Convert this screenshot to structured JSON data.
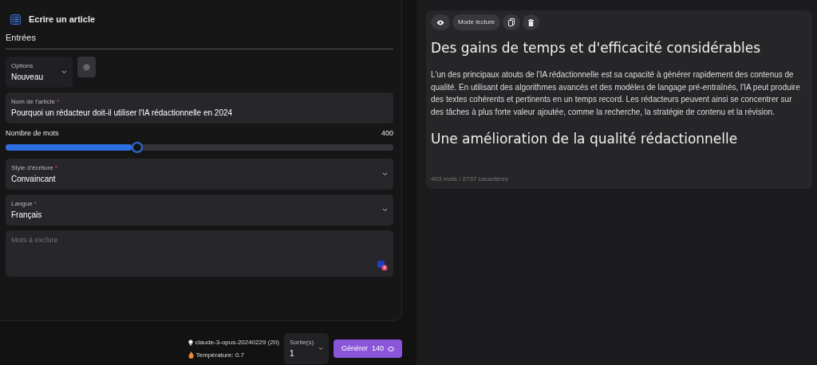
{
  "header": {
    "title": "Ecrire un article"
  },
  "section_title": "Entrées",
  "options_select": {
    "label": "Options",
    "value": "Nouveau"
  },
  "fields": [
    {
      "kind": "input",
      "label": "Nom de l'article",
      "required_mark": "*",
      "value": "Pourquoi un rédacteur doit-il utiliser l'IA rédactionnelle en 2024"
    }
  ],
  "word_count": {
    "label": "Nombre de mots",
    "reading": "400",
    "level": 0.34
  },
  "selects": [
    {
      "label": "Style d'écriture",
      "required_mark": "*",
      "value": "Convaincant"
    },
    {
      "label": "Langue",
      "required_mark": "*",
      "value": "Français"
    }
  ],
  "exclude_field": {
    "placeholder": "Mots à exclure"
  },
  "footer": {
    "model": "claude-3-opus-20240229 (20)",
    "temperature": "Température: 0.7",
    "output_select": {
      "label": "Sortie(s)",
      "value": "1"
    },
    "generate_button": {
      "label": "Générer",
      "cost": "140"
    }
  },
  "preview": {
    "toolbar": {
      "mode_button": "Mode lecture"
    },
    "content": [
      {
        "kind": "heading",
        "text": "Des gains de temps et d'efficacité considérables"
      },
      {
        "kind": "paragraph",
        "text": "L'un des principaux atouts de l'IA rédactionnelle est sa capacité à générer rapidement des contenus de qualité. En utilisant des algorithmes avancés et des modèles de langage pré-entraînés, l'IA peut produire des textes cohérents et pertinents en un temps record. Les rédacteurs peuvent ainsi se concentrer sur des tâches à plus forte valeur ajoutée, comme la recherche, la stratégie de contenu et la révision."
      },
      {
        "kind": "heading",
        "text": "Une amélioration de la qualité rédactionnelle"
      }
    ],
    "stats": "403 mots / 2737 caractères"
  }
}
